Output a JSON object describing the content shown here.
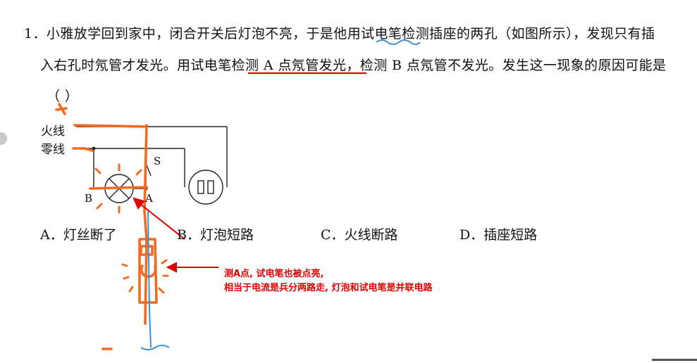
{
  "question": {
    "line1": "1．小雅放学回到家中，闭合开关后灯泡不亮，于是他用试电笔检测插座的两孔（如图所示），发现只有插",
    "line2": "入右孔时氖管才发光。用试电笔检测 A 点氖管发光，检测 B 点氖管不发光。发生这一现象的原因可能是",
    "line3": "（      ）"
  },
  "figure": {
    "live_wire": "火线",
    "neutral_wire": "零线",
    "switch": "S",
    "point_a": "A",
    "point_b": "B"
  },
  "options": [
    "A．灯丝断了",
    "B．灯泡短路",
    "C．火线断路",
    "D．插座短路"
  ],
  "annotation": {
    "line1": "测A点, 试电笔也被点亮,",
    "line2": "相当于电流是兵分两路走, 灯泡和试电笔是并联电路"
  },
  "colors": {
    "ink": "#111111",
    "orange_marker": "#f26a21",
    "blue_marker": "#3a8fd8",
    "red_annotation": "#e00000"
  }
}
